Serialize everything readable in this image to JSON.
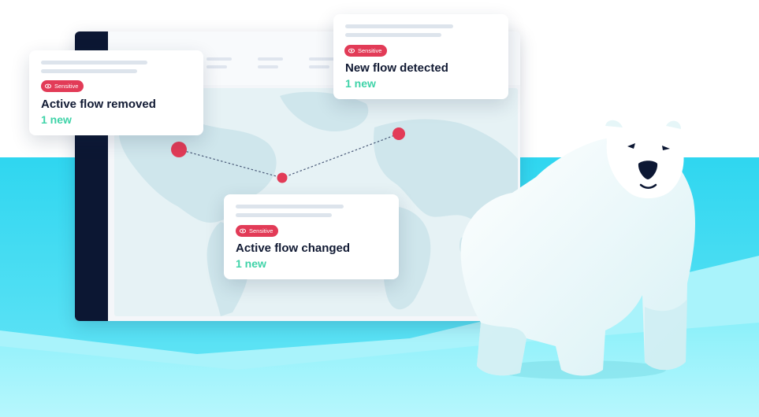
{
  "colors": {
    "sidebar": "#0c1733",
    "badge": "#e23b57",
    "accent_new": "#3fd3a8",
    "ice_cyan": "#31d8f0",
    "marker": "#e23b57"
  },
  "window": {
    "tabs": [
      "",
      "",
      "",
      ""
    ]
  },
  "cards": [
    {
      "id": "removed",
      "badge_label": "Sensitive",
      "badge_icon": "eye-icon",
      "title": "Active flow removed",
      "count_label": "1 new"
    },
    {
      "id": "detected",
      "badge_label": "Sensitive",
      "badge_icon": "eye-icon",
      "title": "New flow detected",
      "count_label": "1 new"
    },
    {
      "id": "changed",
      "badge_label": "Sensitive",
      "badge_icon": "eye-icon",
      "title": "Active flow changed",
      "count_label": "1 new"
    }
  ],
  "map": {
    "markers": [
      "north-america-marker",
      "east-coast-marker",
      "europe-marker"
    ]
  },
  "mascot": "polar-bear-illustration"
}
